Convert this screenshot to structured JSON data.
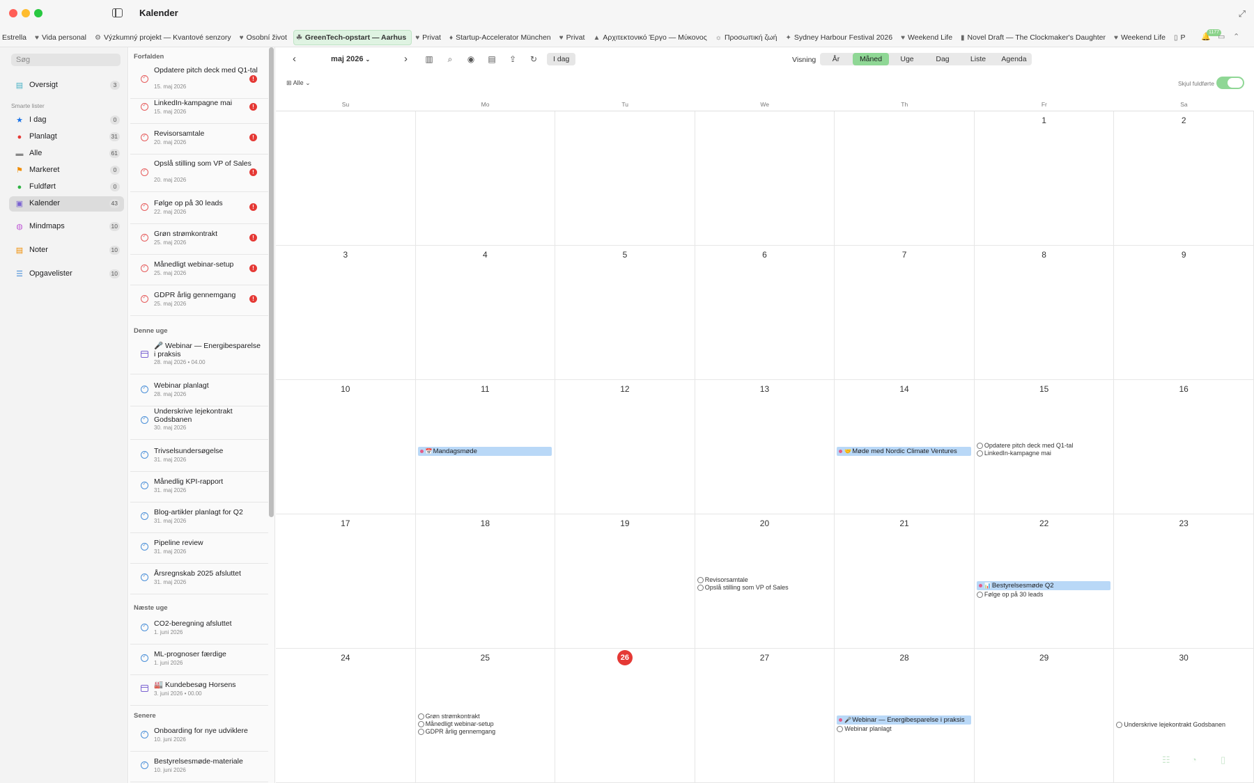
{
  "window": {
    "title": "Kalender"
  },
  "tabs": [
    {
      "icon": "",
      "label": "Estrella",
      "active": false
    },
    {
      "icon": "♥",
      "label": "Vida personal",
      "active": false
    },
    {
      "icon": "⚙",
      "label": "Výzkumný projekt — Kvantové senzory",
      "active": false
    },
    {
      "icon": "♥",
      "label": "Osobní život",
      "active": false
    },
    {
      "icon": "☘",
      "label": "GreenTech-opstart — Aarhus",
      "active": true
    },
    {
      "icon": "♥",
      "label": "Privat",
      "active": false
    },
    {
      "icon": "♦",
      "label": "Startup-Accelerator München",
      "active": false
    },
    {
      "icon": "♥",
      "label": "Privat",
      "active": false
    },
    {
      "icon": "▲",
      "label": "Αρχιτεκτονικό Έργο — Μύκονος",
      "active": false
    },
    {
      "icon": "☼",
      "label": "Προσωπική ζωή",
      "active": false
    },
    {
      "icon": "✦",
      "label": "Sydney Harbour Festival 2026",
      "active": false
    },
    {
      "icon": "♥",
      "label": "Weekend Life",
      "active": false
    },
    {
      "icon": "▮",
      "label": "Novel Draft — The Clockmaker's Daughter",
      "active": false
    },
    {
      "icon": "♥",
      "label": "Weekend Life",
      "active": false
    },
    {
      "icon": "▯",
      "label": "P",
      "active": false
    }
  ],
  "tab_icons": {
    "notification_badge": "1177"
  },
  "sidebar": {
    "search_placeholder": "Søg",
    "overview": {
      "label": "Oversigt",
      "count": "3"
    },
    "smart_section": "Smarte lister",
    "smart": [
      {
        "label": "I dag",
        "count": "0",
        "icon": "star-icon",
        "color": "#1a73e8"
      },
      {
        "label": "Planlagt",
        "count": "31",
        "icon": "planned-icon",
        "color": "#e53935"
      },
      {
        "label": "Alle",
        "count": "61",
        "icon": "inbox-icon",
        "color": "#888888"
      },
      {
        "label": "Markeret",
        "count": "0",
        "icon": "flag-icon",
        "color": "#f08c00"
      },
      {
        "label": "Fuldført",
        "count": "0",
        "icon": "check-icon",
        "color": "#2fb344"
      },
      {
        "label": "Kalender",
        "count": "43",
        "icon": "calendar-icon",
        "color": "#7a62d2"
      }
    ],
    "other": [
      {
        "label": "Mindmaps",
        "count": "10",
        "icon": "mindmap-icon",
        "color": "#c05dd6"
      },
      {
        "label": "Noter",
        "count": "10",
        "icon": "notes-icon",
        "color": "#f08c00"
      },
      {
        "label": "Opgavelister",
        "count": "10",
        "icon": "list-icon",
        "color": "#4a8fd8"
      }
    ]
  },
  "tasks": {
    "groups": [
      {
        "title": "Forfalden",
        "items": [
          {
            "title": "Opdatere pitch deck med Q1-tal",
            "date": "15. maj 2026",
            "kind": "task-overdue"
          },
          {
            "title": "LinkedIn-kampagne mai",
            "date": "15. maj 2026",
            "kind": "task-overdue"
          },
          {
            "title": "Revisorsamtale",
            "date": "20. maj 2026",
            "kind": "task-overdue"
          },
          {
            "title": "Opslå stilling som VP of Sales",
            "date": "20. maj 2026",
            "kind": "task-overdue"
          },
          {
            "title": "Følge op på 30 leads",
            "date": "22. maj 2026",
            "kind": "task-overdue"
          },
          {
            "title": "Grøn strømkontrakt",
            "date": "25. maj 2026",
            "kind": "task-overdue"
          },
          {
            "title": "Månedligt webinar-setup",
            "date": "25. maj 2026",
            "kind": "task-overdue"
          },
          {
            "title": "GDPR årlig gennemgang",
            "date": "25. maj 2026",
            "kind": "task-overdue"
          }
        ]
      },
      {
        "title": "Denne uge",
        "items": [
          {
            "title": "🎤 Webinar — Energibesparelse i praksis",
            "date": "28. maj 2026 • 04.00",
            "kind": "event"
          },
          {
            "title": "Webinar planlagt",
            "date": "28. maj 2026",
            "kind": "task"
          },
          {
            "title": "Underskrive lejekontrakt Godsbanen",
            "date": "30. maj 2026",
            "kind": "task"
          },
          {
            "title": "Trivselsundersøgelse",
            "date": "31. maj 2026",
            "kind": "task"
          },
          {
            "title": "Månedlig KPI-rapport",
            "date": "31. maj 2026",
            "kind": "task"
          },
          {
            "title": "Blog-artikler planlagt for Q2",
            "date": "31. maj 2026",
            "kind": "task"
          },
          {
            "title": "Pipeline review",
            "date": "31. maj 2026",
            "kind": "task"
          },
          {
            "title": "Årsregnskab 2025 afsluttet",
            "date": "31. maj 2026",
            "kind": "task"
          }
        ]
      },
      {
        "title": "Næste uge",
        "items": [
          {
            "title": "CO2-beregning afsluttet",
            "date": "1. juni 2026",
            "kind": "task"
          },
          {
            "title": "ML-prognoser færdige",
            "date": "1. juni 2026",
            "kind": "task"
          },
          {
            "title": "🏭 Kundebesøg Horsens",
            "date": "3. juni 2026 • 00.00",
            "kind": "event"
          }
        ]
      },
      {
        "title": "Senere",
        "items": [
          {
            "title": "Onboarding for nye udviklere",
            "date": "10. juni 2026",
            "kind": "task"
          },
          {
            "title": "Bestyrelsesmøde-materiale",
            "date": "10. juni 2026",
            "kind": "task"
          }
        ]
      }
    ]
  },
  "calendar": {
    "month_label": "maj 2026",
    "today_button": "I dag",
    "view_label": "Visning",
    "views": [
      "År",
      "Måned",
      "Uge",
      "Dag",
      "Liste",
      "Agenda"
    ],
    "active_view": "Måned",
    "filter_label": "Alle",
    "hide_completed_label": "Skjul fuldførte",
    "hide_completed_on": true,
    "weekdays": [
      "Su",
      "Mo",
      "Tu",
      "We",
      "Th",
      "Fr",
      "Sa"
    ],
    "today": "26",
    "weeks": [
      [
        {
          "day": ""
        },
        {
          "day": ""
        },
        {
          "day": ""
        },
        {
          "day": ""
        },
        {
          "day": ""
        },
        {
          "day": "1"
        },
        {
          "day": "2"
        }
      ],
      [
        {
          "day": "3"
        },
        {
          "day": "4"
        },
        {
          "day": "5"
        },
        {
          "day": "6"
        },
        {
          "day": "7"
        },
        {
          "day": "8"
        },
        {
          "day": "9"
        }
      ],
      [
        {
          "day": "10"
        },
        {
          "day": "11",
          "events": [
            {
              "title": "Mandagsmøde",
              "emoji": "📅"
            }
          ]
        },
        {
          "day": "12"
        },
        {
          "day": "13"
        },
        {
          "day": "14",
          "events": [
            {
              "title": "Møde med Nordic Climate Ventures",
              "emoji": "🤝"
            }
          ]
        },
        {
          "day": "15",
          "tasks": [
            "Opdatere pitch deck med Q1-tal",
            "LinkedIn-kampagne mai"
          ]
        },
        {
          "day": "16"
        }
      ],
      [
        {
          "day": "17"
        },
        {
          "day": "18"
        },
        {
          "day": "19"
        },
        {
          "day": "20",
          "tasks": [
            "Revisorsamtale",
            "Opslå stilling som VP of Sales"
          ]
        },
        {
          "day": "21"
        },
        {
          "day": "22",
          "events": [
            {
              "title": "Bestyrelsesmøde Q2",
              "emoji": "📊"
            }
          ],
          "tasks": [
            "Følge op på 30 leads"
          ]
        },
        {
          "day": "23"
        }
      ],
      [
        {
          "day": "24"
        },
        {
          "day": "25",
          "tasks": [
            "Grøn strømkontrakt",
            "Månedligt webinar-setup",
            "GDPR årlig gennemgang"
          ]
        },
        {
          "day": "26"
        },
        {
          "day": "27"
        },
        {
          "day": "28",
          "events": [
            {
              "title": "Webinar — Energibesparelse i praksis",
              "emoji": "🎤"
            }
          ],
          "tasks": [
            "Webinar planlagt"
          ]
        },
        {
          "day": "29"
        },
        {
          "day": "30",
          "tasks": [
            "Underskrive lejekontrakt Godsbanen"
          ]
        }
      ]
    ]
  }
}
